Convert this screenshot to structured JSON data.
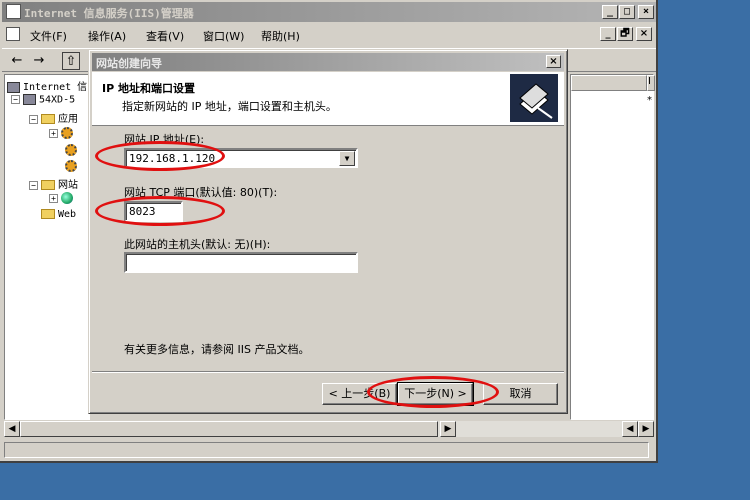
{
  "window": {
    "title": "Internet 信息服务(IIS)管理器",
    "caption_buttons": [
      "_",
      "□",
      "×"
    ],
    "inner_caption_buttons": [
      "_",
      "🗗",
      "×"
    ]
  },
  "menubar": [
    {
      "label": "文件(F)"
    },
    {
      "label": "操作(A)"
    },
    {
      "label": "查看(V)"
    },
    {
      "label": "窗口(W)"
    },
    {
      "label": "帮助(H)"
    }
  ],
  "toolbar": {
    "back": "←",
    "forward": "→",
    "up": "⇧"
  },
  "tree": {
    "root": "Internet 信",
    "server": "54XD-5",
    "app_pools": "应用",
    "websites": "网站",
    "web_ext": "Web"
  },
  "right_pane": {
    "col1": "I",
    "marker": "*"
  },
  "dialog": {
    "title": "网站创建向导",
    "close": "×",
    "header_title": "IP 地址和端口设置",
    "header_subtitle": "指定新网站的 IP 地址，端口设置和主机头。",
    "ip_label": "网站 IP 地址(E):",
    "ip_value": "192.168.1.120",
    "port_label": "网站 TCP 端口(默认值: 80)(T):",
    "port_value": "8023",
    "host_label": "此网站的主机头(默认: 无)(H):",
    "host_value": "",
    "hint": "有关更多信息，请参阅 IIS 产品文档。",
    "back_button": "< 上一步(B)",
    "next_button": "下一步(N) >",
    "cancel_button": "取消"
  },
  "colors": {
    "desktop": "#3a6ea5",
    "highlight_circle": "#e01010"
  }
}
